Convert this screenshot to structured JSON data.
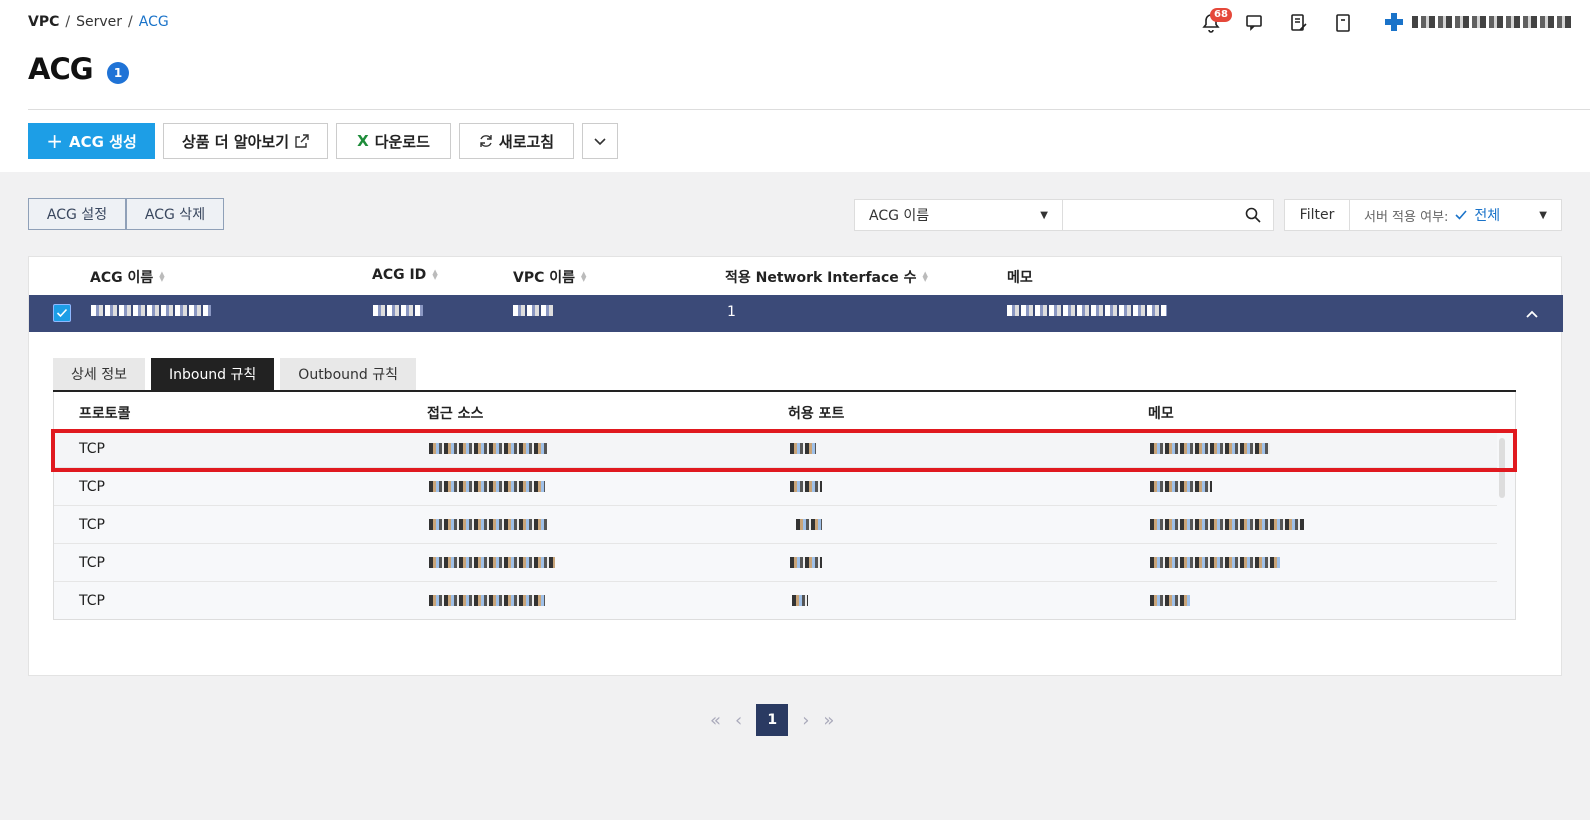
{
  "breadcrumb": [
    "VPC",
    "Server",
    "ACG"
  ],
  "breadcrumb_sep": "/",
  "page": {
    "title": "ACG",
    "count": "1"
  },
  "header": {
    "notification_count": "68"
  },
  "toolbar": {
    "create": "ACG 생성",
    "learn_more": "상품 더 알아보기",
    "download": "다운로드",
    "refresh": "새로고침"
  },
  "actions": {
    "settings": "ACG 설정",
    "delete": "ACG 삭제"
  },
  "search": {
    "field": "ACG 이름",
    "value": ""
  },
  "filter": {
    "label": "Filter",
    "field_label": "서버 적용 여부:",
    "value": "전체"
  },
  "table": {
    "columns": [
      "ACG 이름",
      "ACG ID",
      "VPC 이름",
      "적용 Network Interface 수",
      "메모"
    ],
    "selected_row": {
      "ni_count": "1"
    }
  },
  "detail": {
    "tabs": [
      "상세 정보",
      "Inbound 규칙",
      "Outbound 규칙"
    ],
    "active_tab": "Inbound 규칙",
    "columns": [
      "프로토콜",
      "접근 소스",
      "허용 포트",
      "메모"
    ],
    "rows": [
      {
        "protocol": "TCP"
      },
      {
        "protocol": "TCP"
      },
      {
        "protocol": "TCP"
      },
      {
        "protocol": "TCP"
      },
      {
        "protocol": "TCP"
      }
    ]
  },
  "pagination": {
    "current": "1"
  },
  "colors": {
    "primary": "#1d9ee6",
    "selected_row": "#3b4a78",
    "highlight": "#e0191f"
  }
}
